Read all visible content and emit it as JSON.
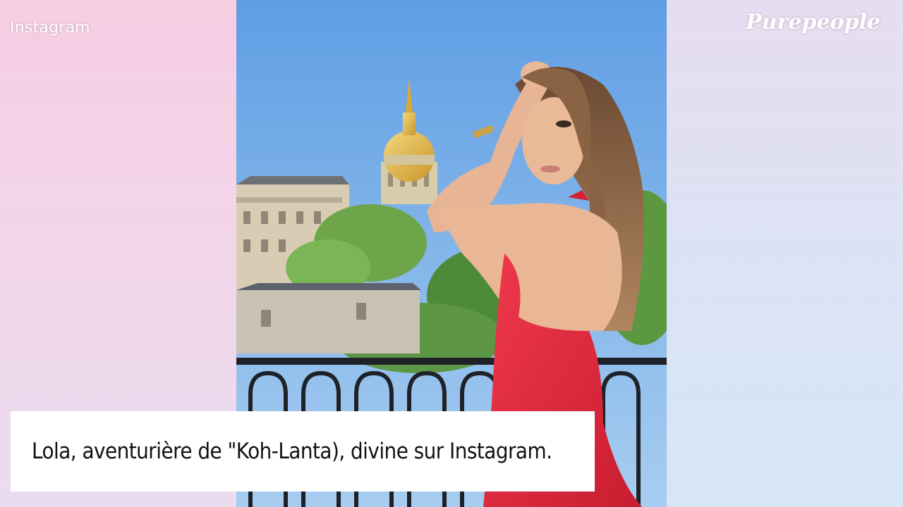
{
  "watermarks": {
    "source_label": "Instagram",
    "brand_logo": "Purepeople"
  },
  "photo": {
    "subject": "woman-in-red-dress-on-balcony",
    "background": "golden-dome-building-trees-blue-sky",
    "dress_color": "#e8283b",
    "sky_color": "#6fa9e6"
  },
  "caption": {
    "text": "Lola, aventurière de \"Koh-Lanta), divine sur Instagram."
  },
  "colors": {
    "bg_pink": "#f6cfe3",
    "bg_blue": "#d7e3f5",
    "caption_bg": "#ffffff"
  }
}
